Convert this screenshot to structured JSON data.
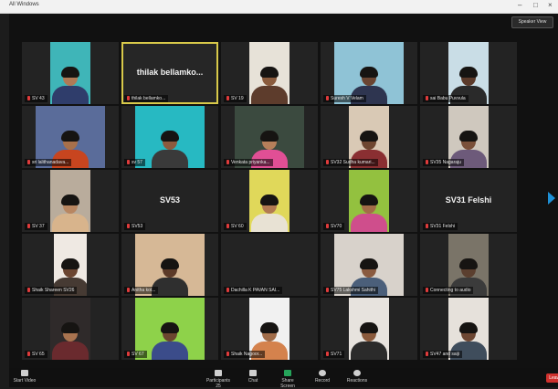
{
  "window": {
    "title": "All Windows",
    "minimize": "–",
    "maximize": "□",
    "close": "×"
  },
  "top_right": {
    "speaker_view_label": "Speaker View"
  },
  "tiles": [
    {
      "name": "SV 43",
      "video": true,
      "bg": "#3fb5b8",
      "skin": "#b07a56",
      "shirt": "#2f3d6b"
    },
    {
      "name": "thilak bellamko...",
      "video": false,
      "active": true,
      "big_label": "thilak bellamko..."
    },
    {
      "name": "SV 19",
      "video": true,
      "bg": "#e7e2d8",
      "skin": "#8a5b3d",
      "shirt": "#5d3c2c"
    },
    {
      "name": "Suresh V Velam",
      "video": true,
      "bg": "#8fc3d6",
      "skin": "#6a4532",
      "shirt": "#2e3550"
    },
    {
      "name": "sai Babu Puvvula",
      "video": true,
      "bg": "#c9dde6",
      "skin": "#5b3a2a",
      "shirt": "#2a2a2a"
    },
    {
      "name": "sri lalithanadava...",
      "video": true,
      "bg": "#5a6c9a",
      "skin": "#a8704b",
      "shirt": "#c8451f"
    },
    {
      "name": "sv 57",
      "video": true,
      "bg": "#27b9c2",
      "skin": "#8c5a3e",
      "shirt": "#3a3a3a"
    },
    {
      "name": "Venkata priyanka...",
      "video": true,
      "bg": "#3b4a3f",
      "skin": "#b67f5a",
      "shirt": "#e14f95"
    },
    {
      "name": "SV32 Sudha kumari...",
      "video": true,
      "bg": "#d9c9b5",
      "skin": "#6e4630",
      "shirt": "#8a2f32"
    },
    {
      "name": "SV35 Nagaraju",
      "video": true,
      "bg": "#cfc8be",
      "skin": "#7a503a",
      "shirt": "#6d5a7a"
    },
    {
      "name": "SV 37",
      "video": true,
      "bg": "#b9ac9c",
      "skin": "#b88661",
      "shirt": "#d8b48c"
    },
    {
      "name": "SV53",
      "video": false,
      "big_label": "SV53"
    },
    {
      "name": "SV 60",
      "video": true,
      "bg": "#e0d85a",
      "skin": "#b27a52",
      "shirt": "#e8e2d4"
    },
    {
      "name": "SV70",
      "video": true,
      "bg": "#93c13f",
      "skin": "#a36c48",
      "shirt": "#cf4e8c"
    },
    {
      "name": "SV31 Felshi",
      "video": false,
      "big_label": "SV31 Felshi"
    },
    {
      "name": "Shaik Shareen SV26",
      "video": true,
      "bg": "#efe9e3",
      "skin": "#6b4531",
      "shirt": "#463a33"
    },
    {
      "name": "Anitha kot...",
      "video": true,
      "bg": "#d6b896",
      "skin": "#5c3a28",
      "shirt": "#2f2f2f"
    },
    {
      "name": "Dachilla K PAVAN SAI...",
      "video": false,
      "big_label": ""
    },
    {
      "name": "SV75 Lakshmi Sahithi",
      "video": true,
      "bg": "#d8d2cb",
      "skin": "#8a5b40",
      "shirt": "#4b5f7a"
    },
    {
      "name": "Connecting to audio",
      "video": true,
      "bg": "#7a7468",
      "skin": "#5b3f2f",
      "shirt": "#3b3b3b"
    },
    {
      "name": "SV 65",
      "video": true,
      "bg": "#2f2a2a",
      "skin": "#a9734f",
      "shirt": "#6a2a2e"
    },
    {
      "name": "SV 67",
      "video": true,
      "bg": "#8ed24a",
      "skin": "#6b452f",
      "shirt": "#3b4c8a"
    },
    {
      "name": "Shaik Nagoor...",
      "video": true,
      "bg": "#f1f1f1",
      "skin": "#a06c49",
      "shirt": "#d4824d"
    },
    {
      "name": "SV71",
      "video": true,
      "bg": "#e7e3de",
      "skin": "#8a5a3c",
      "shirt": "#2b2b2b"
    },
    {
      "name": "SV47 and saiji",
      "video": true,
      "bg": "#e6e1db",
      "skin": "#6d4733",
      "shirt": "#3f4d5c"
    }
  ],
  "toolbar": {
    "left": {
      "label": "Start Video"
    },
    "items": [
      {
        "label": "Participants",
        "count": "25"
      },
      {
        "label": "Chat"
      },
      {
        "label": "Share Screen"
      },
      {
        "label": "Record"
      },
      {
        "label": "Reactions"
      }
    ],
    "end": "Leave"
  },
  "colors": {
    "active_border": "#d8c94a",
    "share": "#25a45a",
    "end": "#d0312d",
    "nav_arrow": "#1e90d6"
  }
}
